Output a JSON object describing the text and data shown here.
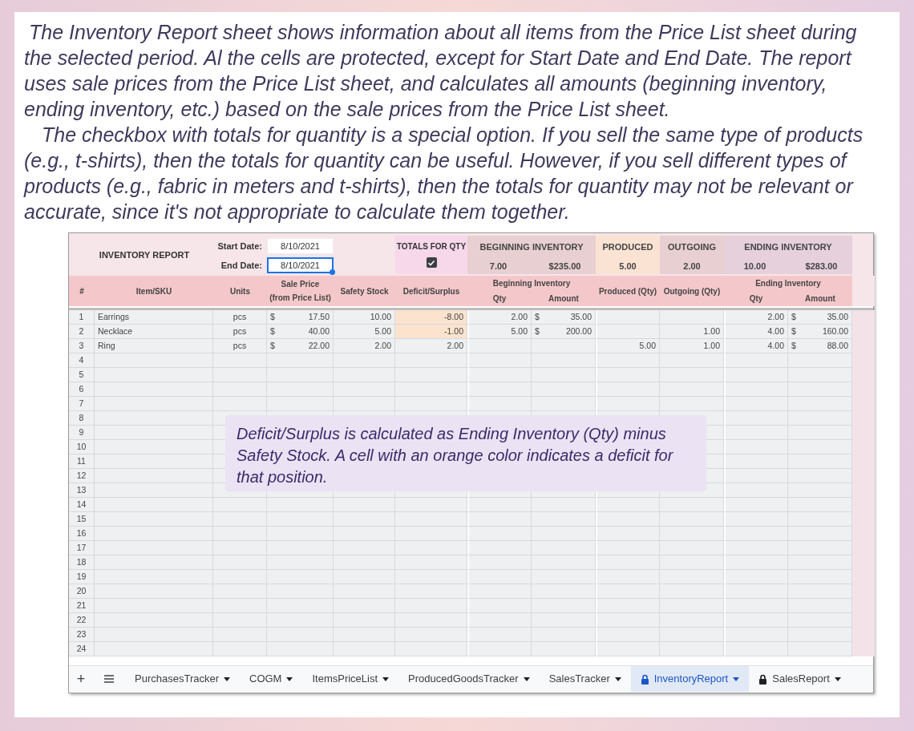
{
  "intro": [
    "The Inventory Report sheet shows information about all items from the Price List sheet during the selected period. Al the cells are protected, except for Start Date and End Date. The report uses sale prices from the Price List sheet, and calculates all amounts (beginning inventory, ending inventory, etc.) based on the sale prices from the Price List sheet.",
    "The checkbox with totals for quantity is a special option. If you sell the same type of products (e.g., t-shirts), then the totals for quantity can be useful. However, if you sell different types of products (e.g., fabric in meters and t-shirts), then the totals for quantity may not be relevant or accurate, since it's not appropriate to calculate them together."
  ],
  "sheet": {
    "title": "INVENTORY REPORT",
    "dates": [
      {
        "label": "Start Date:",
        "value": "8/10/2021",
        "selected": false
      },
      {
        "label": "End Date:",
        "value": "8/10/2021",
        "selected": true
      }
    ],
    "totals_toggle": {
      "label": "TOTALS FOR QTY",
      "checked": true
    },
    "summary": [
      {
        "label": "BEGINNING INVENTORY",
        "values": [
          "7.00",
          "$235.00"
        ],
        "color": "#e8cfd1"
      },
      {
        "label": "PRODUCED",
        "values": [
          "5.00"
        ],
        "color": "#fbe3d3"
      },
      {
        "label": "OUTGOING",
        "values": [
          "2.00"
        ],
        "color": "#e8cfd1"
      },
      {
        "label": "ENDING INVENTORY",
        "values": [
          "10.00",
          "$283.00"
        ],
        "color": "#e5d0dc"
      }
    ],
    "columns": {
      "num": "#",
      "item": "Item/SKU",
      "units": "Units",
      "price": [
        "Sale Price",
        "(from Price List)"
      ],
      "safety": "Safety Stock",
      "deficit": "Deficit/Surplus",
      "beginning": [
        "Beginning Inventory",
        "Qty",
        "Amount"
      ],
      "produced": "Produced (Qty)",
      "outgoing": "Outgoing (Qty)",
      "ending": [
        "Ending Inventory",
        "Qty",
        "Amount"
      ]
    },
    "rows": [
      {
        "num": "1",
        "item": "Earrings",
        "units": "pcs",
        "price_symbol": "$",
        "price": "17.50",
        "safety": "10.00",
        "deficit": "-8.00",
        "is_deficit": true,
        "beg_qty": "2.00",
        "beg_symbol": "$",
        "beg_amount": "35.00",
        "end_qty": "2.00",
        "end_symbol": "$",
        "end_amount": "35.00"
      },
      {
        "num": "2",
        "item": "Necklace",
        "units": "pcs",
        "price_symbol": "$",
        "price": "40.00",
        "safety": "5.00",
        "deficit": "-1.00",
        "is_deficit": true,
        "beg_qty": "5.00",
        "beg_symbol": "$",
        "beg_amount": "200.00",
        "outgoing": "1.00",
        "end_qty": "4.00",
        "end_symbol": "$",
        "end_amount": "160.00"
      },
      {
        "num": "3",
        "item": "Ring",
        "units": "pcs",
        "price_symbol": "$",
        "price": "22.00",
        "safety": "2.00",
        "deficit": "2.00",
        "is_deficit": false,
        "produced": "5.00",
        "outgoing": "1.00",
        "end_qty": "4.00",
        "end_symbol": "$",
        "end_amount": "88.00"
      },
      {
        "num": "4"
      },
      {
        "num": "5"
      },
      {
        "num": "6"
      },
      {
        "num": "7"
      },
      {
        "num": "8"
      },
      {
        "num": "9"
      },
      {
        "num": "10"
      },
      {
        "num": "11"
      },
      {
        "num": "12"
      },
      {
        "num": "13"
      },
      {
        "num": "14"
      },
      {
        "num": "15"
      },
      {
        "num": "16"
      },
      {
        "num": "17"
      },
      {
        "num": "18"
      },
      {
        "num": "19"
      },
      {
        "num": "20"
      },
      {
        "num": "21"
      },
      {
        "num": "22"
      },
      {
        "num": "23"
      },
      {
        "num": "24"
      }
    ],
    "note": "Deficit/Surplus is calculated as Ending Inventory (Qty) minus Safety Stock. A cell with an orange color indicates a deficit for that position.",
    "add_sheet": "+",
    "tabs": [
      {
        "label": "PurchasesTracker",
        "selected": false,
        "locked": false
      },
      {
        "label": "COGM",
        "selected": false,
        "locked": false
      },
      {
        "label": "ItemsPriceList",
        "selected": false,
        "locked": false
      },
      {
        "label": "ProducedGoodsTracker",
        "selected": false,
        "locked": false
      },
      {
        "label": "SalesTracker",
        "selected": false,
        "locked": false
      },
      {
        "label": "InventoryReport",
        "selected": true,
        "locked": true
      },
      {
        "label": "SalesReport",
        "selected": false,
        "locked": true
      }
    ]
  }
}
